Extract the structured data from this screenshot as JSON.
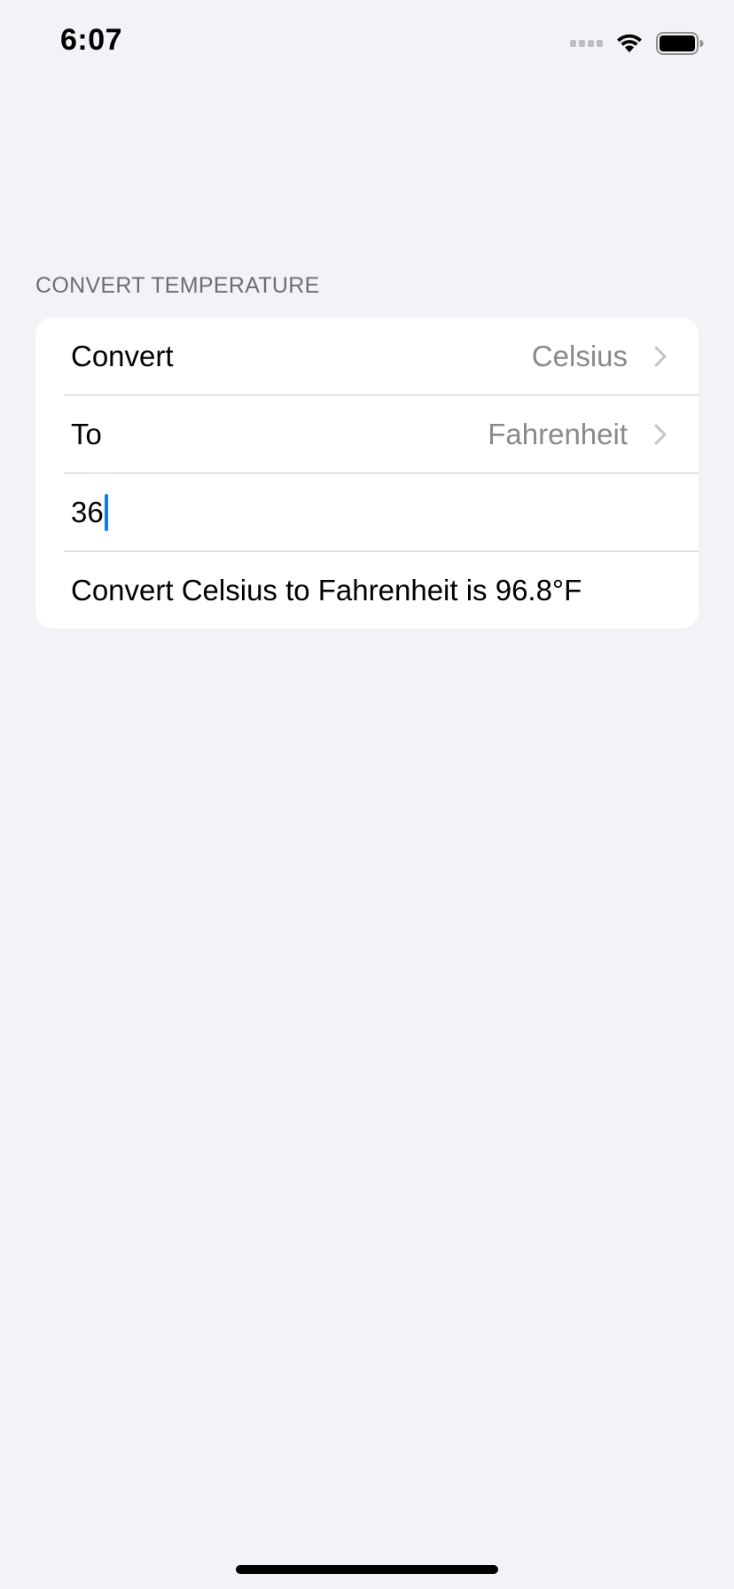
{
  "status_bar": {
    "time": "6:07"
  },
  "section": {
    "header": "CONVERT TEMPERATURE"
  },
  "form": {
    "convert_label": "Convert",
    "convert_value": "Celsius",
    "to_label": "To",
    "to_value": "Fahrenheit",
    "input_value": "36",
    "result_text": "Convert Celsius to Fahrenheit is 96.8°F"
  },
  "colors": {
    "background": "#f2f2f7",
    "accent": "#0a7bff",
    "secondary_text": "#8a8a8e"
  },
  "icons": {
    "signal": "signal-icon",
    "wifi": "wifi-icon",
    "battery": "battery-icon",
    "chevron": "chevron-right-icon"
  }
}
